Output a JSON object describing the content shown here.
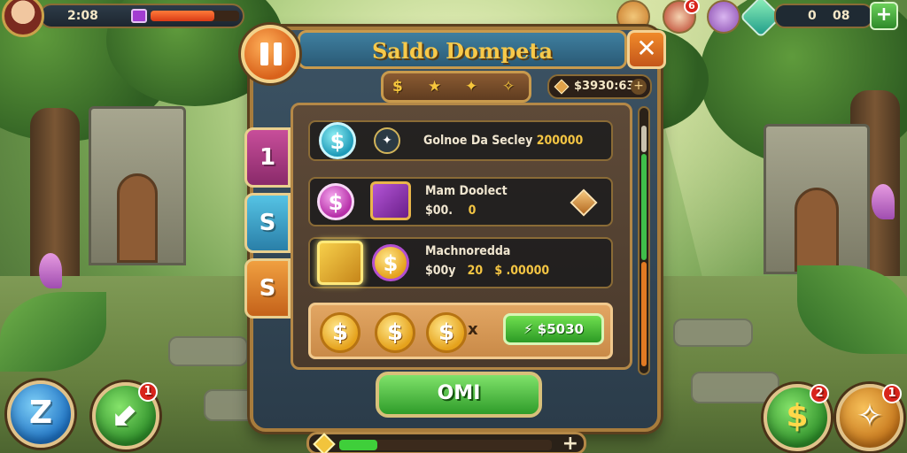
{
  "hud": {
    "time": "2:08",
    "energy_fraction": 0.72,
    "resource_left": "0",
    "resource_right": "08",
    "plus_label": "+",
    "avatar_badge": "6"
  },
  "dialog": {
    "title": "Saldo Dompeta",
    "close_label": "✕",
    "tabs": [
      "$",
      "★",
      "✦",
      "✧"
    ],
    "coins_amount": "$3930:63",
    "coins_plus": "+",
    "side_tabs": [
      "1",
      "S",
      "S"
    ]
  },
  "rows": [
    {
      "icon_label": "$",
      "label": "Golnoe Da Secley",
      "value": "200000"
    },
    {
      "icon_label": "$",
      "label": "Mam Doolect",
      "amount": "$00.",
      "value": "0"
    },
    {
      "icon_label": "$",
      "label": "Machnoredda",
      "amount": "$00y",
      "count": "20",
      "value": "$ .00000"
    }
  ],
  "offer": {
    "coin_label": "$",
    "times": "x",
    "price": "$5030"
  },
  "ok_label": "OMI",
  "progress_fraction": 0.18,
  "corner_buttons": {
    "left_1_badge": "",
    "left_2_badge": "1",
    "right_1_badge": "2",
    "right_1_label": "$",
    "right_2_badge": "1"
  },
  "colors": {
    "accent_gold": "#f7c94a",
    "panel_blue": "#3f7fa0",
    "frame_brown": "#a87c3c",
    "buy_green": "#2c9a25",
    "energy_orange": "#e0441b"
  }
}
